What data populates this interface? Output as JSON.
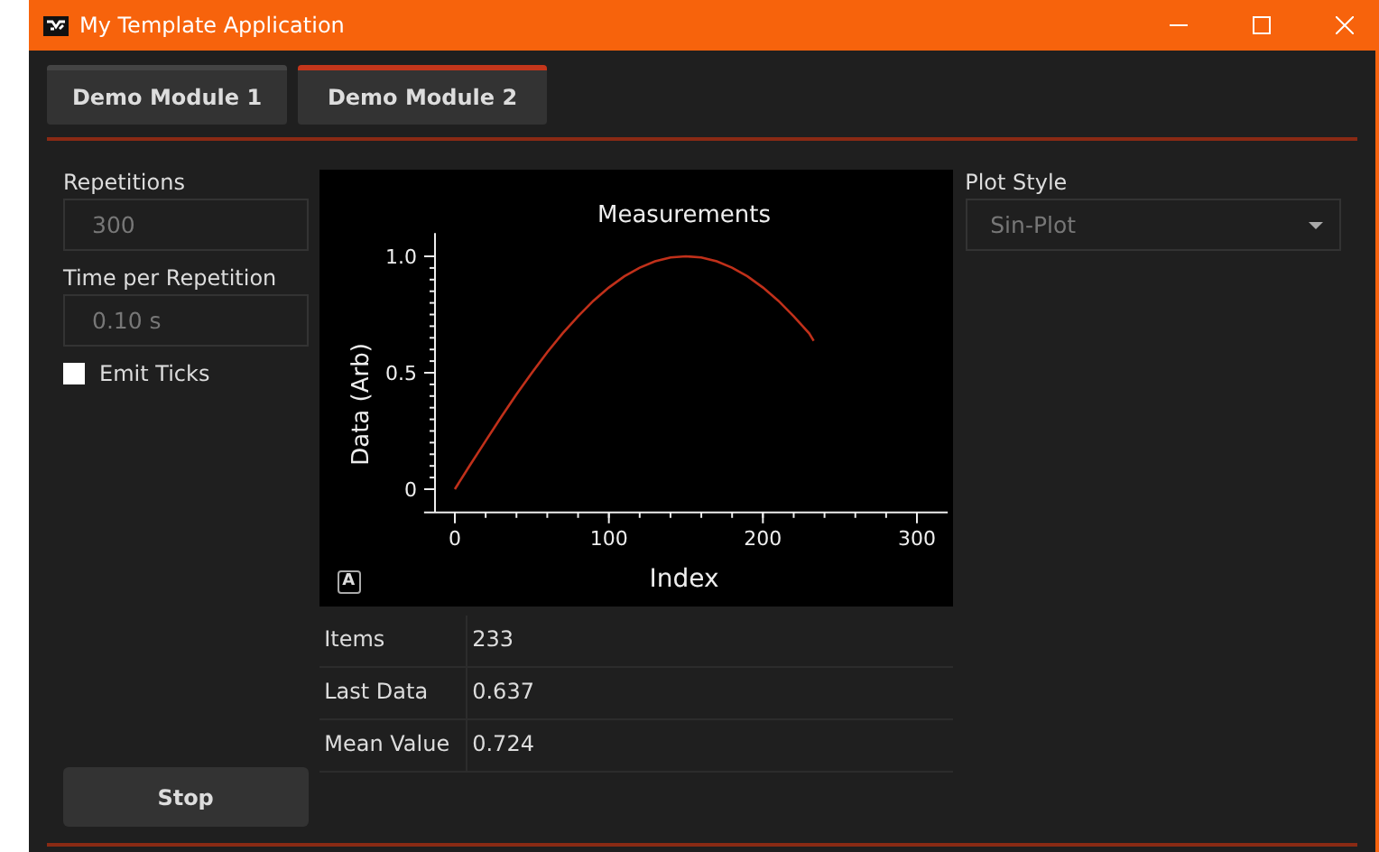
{
  "window": {
    "title": "My Template Application"
  },
  "tabs": [
    {
      "label": "Demo Module 1",
      "selected": false
    },
    {
      "label": "Demo Module 2",
      "selected": true
    }
  ],
  "fields": [
    {
      "label": "Repetitions",
      "value": "300",
      "disabled": true
    },
    {
      "label": "Time per Repetition",
      "value": "0.10 s",
      "disabled": true
    }
  ],
  "emit_ticks": {
    "label": "Emit Ticks",
    "checked": false
  },
  "stop_button": "Stop",
  "chart": {
    "chart_data": {
      "type": "line",
      "title": "Measurements",
      "xlabel": "Index",
      "ylabel": "Data (Arb)",
      "xlim": [
        -20,
        320
      ],
      "ylim": [
        -0.1,
        1.1
      ],
      "xticks": [
        0,
        100,
        200,
        300
      ],
      "yticks": [
        {
          "value": 0,
          "label": "0"
        },
        {
          "value": 0.5,
          "label": "0.5"
        },
        {
          "value": 1,
          "label": "1.0"
        }
      ],
      "series": [
        {
          "color": "#c0301a",
          "x": [
            0,
            10,
            20,
            30,
            40,
            50,
            60,
            70,
            80,
            90,
            100,
            110,
            120,
            130,
            140,
            150,
            160,
            170,
            180,
            190,
            200,
            210,
            220,
            230,
            233
          ],
          "values": [
            0,
            0.105,
            0.208,
            0.309,
            0.407,
            0.5,
            0.588,
            0.669,
            0.743,
            0.809,
            0.866,
            0.914,
            0.951,
            0.978,
            0.995,
            1,
            0.995,
            0.978,
            0.951,
            0.914,
            0.866,
            0.809,
            0.743,
            0.669,
            0.637
          ]
        }
      ]
    },
    "autoscale_button": "A"
  },
  "stats": [
    {
      "label": "Items",
      "value": "233"
    },
    {
      "label": "Last Data",
      "value": "0.637"
    },
    {
      "label": "Mean Value",
      "value": "0.724"
    }
  ],
  "plot_style": {
    "label": "Plot Style",
    "value": "Sin-Plot"
  }
}
